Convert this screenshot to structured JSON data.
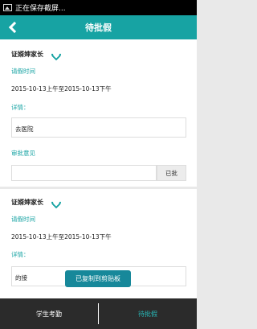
{
  "status_bar": {
    "notification_text": "正在保存截屏..."
  },
  "header": {
    "title": "待批假"
  },
  "requests": [
    {
      "name": "证婿婶家长",
      "time_label": "请假时间",
      "time_value": "2015-10-13上午至2015-10-13下午",
      "detail_label": "详情：",
      "detail_value": "去医院",
      "opinion_label": "审批意见",
      "opinion_value": "",
      "approve_label": "已批"
    },
    {
      "name": "证婿婶家长",
      "time_label": "请假时间",
      "time_value": "2015-10-13上午至2015-10-13下午",
      "detail_label": "详情：",
      "detail_value": "的接"
    }
  ],
  "toast": {
    "text": "已复制到剪贴板"
  },
  "tabs": [
    {
      "label": "学生考勤",
      "active": false
    },
    {
      "label": "待批假",
      "active": true
    }
  ],
  "colors": {
    "accent": "#17a3a3",
    "bottom_bar": "#2b2b2b"
  }
}
